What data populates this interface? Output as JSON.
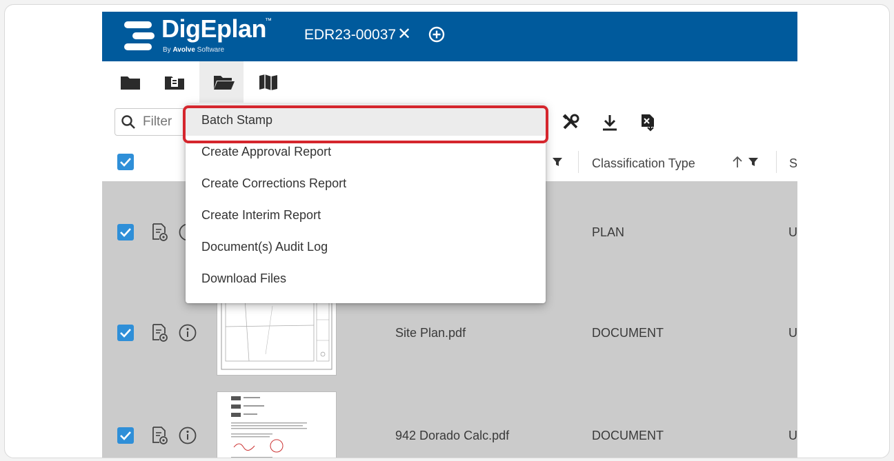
{
  "header": {
    "logo_text": "DigEplan",
    "logo_tm": "™",
    "logo_by": "By ",
    "logo_company": "Avolve",
    "logo_suffix": " Software",
    "case_id": "EDR23-00037",
    "close_glyph": "✕"
  },
  "tabs": [
    {
      "name": "folder-closed",
      "active": false
    },
    {
      "name": "folder-document",
      "active": false
    },
    {
      "name": "folder-open",
      "active": true
    },
    {
      "name": "map",
      "active": false
    }
  ],
  "toolbar": {
    "filter_placeholder": "Filter"
  },
  "table": {
    "columns": [
      {
        "label": "Classification Type"
      },
      {
        "label": "St"
      }
    ]
  },
  "rows": [
    {
      "name": "",
      "classification": "PLAN",
      "status": "U|"
    },
    {
      "name": "Site Plan.pdf",
      "classification": "DOCUMENT",
      "status": "U|"
    },
    {
      "name": "942 Dorado Calc.pdf",
      "classification": "DOCUMENT",
      "status": "U|"
    }
  ],
  "menu": {
    "items": [
      {
        "label": "Batch Stamp",
        "highlighted": true
      },
      {
        "label": "Create Approval Report"
      },
      {
        "label": "Create Corrections Report"
      },
      {
        "label": "Create Interim Report"
      },
      {
        "label": "Document(s) Audit Log"
      },
      {
        "label": "Download Files"
      }
    ]
  },
  "colors": {
    "brand_blue": "#005a9c",
    "checkbox_blue": "#2f8fd8",
    "highlight_red": "#d5262d",
    "row_bg": "#cbcbcb"
  }
}
